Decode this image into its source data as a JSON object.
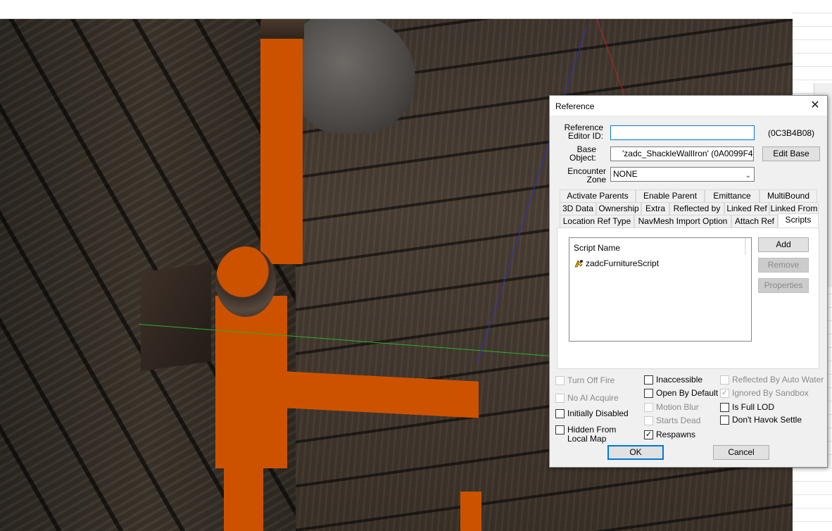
{
  "dialog": {
    "title": "Reference",
    "close_glyph": "✕",
    "editor_id_label_1": "Reference",
    "editor_id_label_2": "Editor ID:",
    "editor_id_value": "",
    "form_id": "(0C3B4B08)",
    "base_object_label_1": "Base",
    "base_object_label_2": "Object:",
    "base_object_value": "'zadc_ShackleWallIron' (0A0099F4)",
    "edit_base_label": "Edit Base",
    "encounter_zone_label_1": "Encounter",
    "encounter_zone_label_2": "Zone",
    "encounter_zone_value": "NONE"
  },
  "tabs": {
    "row1": [
      "Activate Parents",
      "Enable Parent",
      "Emittance",
      "MultiBound"
    ],
    "row2": [
      "3D Data",
      "Ownership",
      "Extra",
      "Reflected by",
      "Linked Ref",
      "Linked From"
    ],
    "row3": [
      "Location Ref Type",
      "NavMesh Import Option",
      "Attach Ref",
      "Scripts"
    ],
    "active": "Scripts"
  },
  "scripts": {
    "column_header": "Script Name",
    "items": [
      "zadcFurnitureScript"
    ],
    "add_label": "Add",
    "remove_label": "Remove",
    "properties_label": "Properties"
  },
  "flags": {
    "col1": [
      {
        "label": "Turn Off Fire",
        "checked": false,
        "enabled": false
      },
      {
        "label": "No AI Acquire",
        "checked": false,
        "enabled": false
      },
      {
        "label": "Initially Disabled",
        "checked": false,
        "enabled": true
      },
      {
        "label": "Hidden From",
        "label2": "Local Map",
        "checked": false,
        "enabled": true
      }
    ],
    "col2": [
      {
        "label": "Inaccessible",
        "checked": false,
        "enabled": true
      },
      {
        "label": "Open By Default",
        "checked": false,
        "enabled": true
      },
      {
        "label": "Motion Blur",
        "checked": false,
        "enabled": false
      },
      {
        "label": "Starts Dead",
        "checked": false,
        "enabled": false
      },
      {
        "label": "Respawns",
        "checked": true,
        "enabled": true
      }
    ],
    "col3": [
      {
        "label": "Reflected By Auto Water",
        "checked": false,
        "enabled": false
      },
      {
        "label": "Ignored By Sandbox",
        "checked": true,
        "enabled": false
      },
      {
        "label": "Is Full LOD",
        "checked": false,
        "enabled": true
      },
      {
        "label": "Don't Havok Settle",
        "checked": false,
        "enabled": true
      }
    ]
  },
  "footer": {
    "ok_label": "OK",
    "cancel_label": "Cancel"
  },
  "colors": {
    "highlight_orange": "#cc5200",
    "focus_blue": "#0078d7",
    "dialog_bg": "#f0f0f0"
  }
}
